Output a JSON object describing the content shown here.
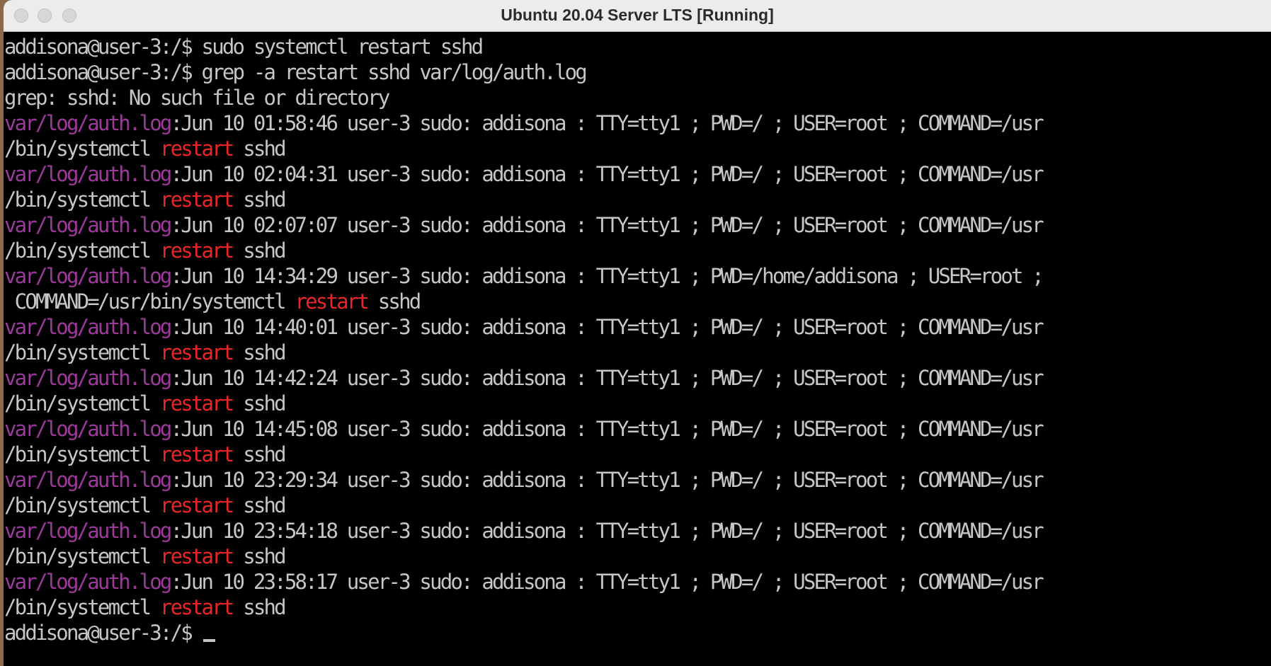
{
  "window": {
    "title": "Ubuntu 20.04 Server LTS [Running]"
  },
  "terminal": {
    "prompt": "addisona@user-3:/$ ",
    "commands": [
      "sudo systemctl restart sshd",
      "grep -a restart sshd var/log/auth.log"
    ],
    "error": "grep: sshd: No such file or directory",
    "file_prefix": "var/log/auth.log",
    "match_word": "restart",
    "entries": [
      {
        "line1": ":Jun 10 01:58:46 user-3 sudo: addisona : TTY=tty1 ; PWD=/ ; USER=root ; COMMAND=/usr",
        "line2_pre": "/bin/systemctl ",
        "line2_post": " sshd"
      },
      {
        "line1": ":Jun 10 02:04:31 user-3 sudo: addisona : TTY=tty1 ; PWD=/ ; USER=root ; COMMAND=/usr",
        "line2_pre": "/bin/systemctl ",
        "line2_post": " sshd"
      },
      {
        "line1": ":Jun 10 02:07:07 user-3 sudo: addisona : TTY=tty1 ; PWD=/ ; USER=root ; COMMAND=/usr",
        "line2_pre": "/bin/systemctl ",
        "line2_post": " sshd"
      },
      {
        "line1": ":Jun 10 14:34:29 user-3 sudo: addisona : TTY=tty1 ; PWD=/home/addisona ; USER=root ;",
        "line2_pre": " COMMAND=/usr/bin/systemctl ",
        "line2_post": " sshd"
      },
      {
        "line1": ":Jun 10 14:40:01 user-3 sudo: addisona : TTY=tty1 ; PWD=/ ; USER=root ; COMMAND=/usr",
        "line2_pre": "/bin/systemctl ",
        "line2_post": " sshd"
      },
      {
        "line1": ":Jun 10 14:42:24 user-3 sudo: addisona : TTY=tty1 ; PWD=/ ; USER=root ; COMMAND=/usr",
        "line2_pre": "/bin/systemctl ",
        "line2_post": " sshd"
      },
      {
        "line1": ":Jun 10 14:45:08 user-3 sudo: addisona : TTY=tty1 ; PWD=/ ; USER=root ; COMMAND=/usr",
        "line2_pre": "/bin/systemctl ",
        "line2_post": " sshd"
      },
      {
        "line1": ":Jun 10 23:29:34 user-3 sudo: addisona : TTY=tty1 ; PWD=/ ; USER=root ; COMMAND=/usr",
        "line2_pre": "/bin/systemctl ",
        "line2_post": " sshd"
      },
      {
        "line1": ":Jun 10 23:54:18 user-3 sudo: addisona : TTY=tty1 ; PWD=/ ; USER=root ; COMMAND=/usr",
        "line2_pre": "/bin/systemctl ",
        "line2_post": " sshd"
      },
      {
        "line1": ":Jun 10 23:58:17 user-3 sudo: addisona : TTY=tty1 ; PWD=/ ; USER=root ; COMMAND=/usr",
        "line2_pre": "/bin/systemctl ",
        "line2_post": " sshd"
      }
    ]
  },
  "colors": {
    "text": "#c6c6c6",
    "file": "#9b3a9c",
    "match": "#e8262a",
    "background": "#000000"
  }
}
